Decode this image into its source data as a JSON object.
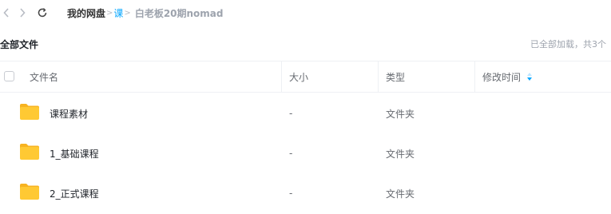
{
  "breadcrumb": {
    "root": "我的网盘",
    "separator": ">",
    "middle": "课",
    "current": "白老板20期nomad"
  },
  "section": {
    "title": "全部文件",
    "load_status": "已全部加载，共3个"
  },
  "columns": {
    "name": "文件名",
    "size": "大小",
    "type": "类型",
    "modified": "修改时间"
  },
  "files": [
    {
      "name": "课程素材",
      "size": "-",
      "type": "文件夹",
      "icon": "folder-icon"
    },
    {
      "name": "1_基础课程",
      "size": "-",
      "type": "文件夹",
      "icon": "folder-icon"
    },
    {
      "name": "2_正式课程",
      "size": "-",
      "type": "文件夹",
      "icon": "folder-icon"
    }
  ],
  "colors": {
    "accent": "#06a7ff",
    "folder": "#ffc933",
    "folder_tab": "#f7b321"
  }
}
